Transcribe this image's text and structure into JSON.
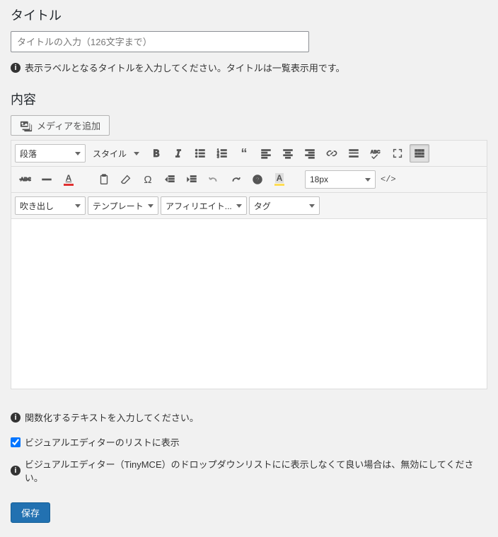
{
  "title_section": {
    "heading": "タイトル",
    "placeholder": "タイトルの入力（126文字まで）",
    "help": "表示ラベルとなるタイトルを入力してください。タイトルは一覧表示用です。"
  },
  "content_section": {
    "heading": "内容",
    "media_button": "メディアを追加",
    "help": "関数化するテキストを入力してください。"
  },
  "toolbar": {
    "paragraph": "段落",
    "style": "スタイル",
    "fontsize": "18px",
    "speech": "吹き出し",
    "template": "テンプレート",
    "affiliate": "アフィリエイト...",
    "tag": "タグ",
    "code_btn": "</>"
  },
  "visual_editor": {
    "checkbox_label": "ビジュアルエディターのリストに表示",
    "help": "ビジュアルエディター（TinyMCE）のドロップダウンリストにに表示しなくて良い場合は、無効にしてください。"
  },
  "save_button": "保存"
}
